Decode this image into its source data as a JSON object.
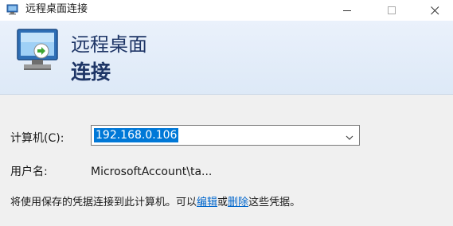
{
  "window": {
    "title": "远程桌面连接",
    "minimize_icon": "minimize-icon",
    "maximize_icon": "maximize-icon",
    "close_icon": "close-icon"
  },
  "banner": {
    "line1": "远程桌面",
    "line2": "连接",
    "icon": "remote-desktop-icon"
  },
  "form": {
    "computer_label": "计算机(C):",
    "computer_value": "192.168.0.106",
    "user_label": "用户名:",
    "user_value": "MicrosoftAccount\\ta..."
  },
  "info": {
    "prefix": "将使用保存的凭据连接到此计算机。可以",
    "edit_link": "编辑",
    "middle": "或",
    "delete_link": "删除",
    "suffix": "这些凭据。"
  },
  "colors": {
    "accent": "#0078d7",
    "link": "#0066cc",
    "banner_text": "#1e3566"
  }
}
